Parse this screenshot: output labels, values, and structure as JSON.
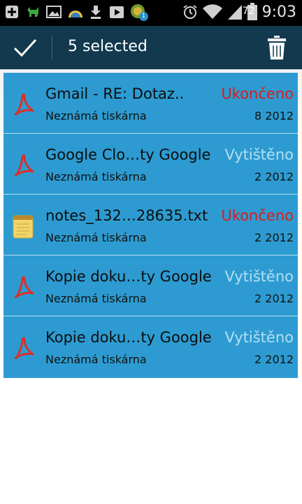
{
  "status_bar": {
    "icons": [
      "plus-icon",
      "android-icon",
      "gallery-icon",
      "weather-icon",
      "download-icon",
      "play-store-icon",
      "chat-icon",
      "alarm-icon",
      "wifi-icon",
      "signal-icon",
      "battery-icon"
    ],
    "badge": "1",
    "battery_level": "72",
    "time": "9:03"
  },
  "action_bar": {
    "done_icon": "check-icon",
    "title": "5 selected",
    "delete_icon": "trash-icon"
  },
  "colors": {
    "selected_bg": "#2d9bd1",
    "status_failed": "#dd1a1a",
    "status_printed": "#b3dff3",
    "action_bar": "#13394e"
  },
  "jobs": [
    {
      "icon": "pdf-icon",
      "title": "Gmail - RE: Dotaz..",
      "status": "Ukončeno",
      "status_kind": "failed",
      "printer": "Neznámá tiskárna",
      "date": "8 2012"
    },
    {
      "icon": "pdf-icon",
      "title": "Google Clo…ty Google",
      "status": "Vytištěno",
      "status_kind": "printed",
      "printer": "Neznámá tiskárna",
      "date": "2 2012"
    },
    {
      "icon": "notes-icon",
      "title": "notes_132…28635.txt",
      "status": "Ukončeno",
      "status_kind": "failed",
      "printer": "Neznámá tiskárna",
      "date": "2 2012"
    },
    {
      "icon": "pdf-icon",
      "title": "Kopie doku…ty Google",
      "status": "Vytištěno",
      "status_kind": "printed",
      "printer": "Neznámá tiskárna",
      "date": "2 2012"
    },
    {
      "icon": "pdf-icon",
      "title": "Kopie doku…ty Google",
      "status": "Vytištěno",
      "status_kind": "printed",
      "printer": "Neznámá tiskárna",
      "date": "2 2012"
    }
  ]
}
